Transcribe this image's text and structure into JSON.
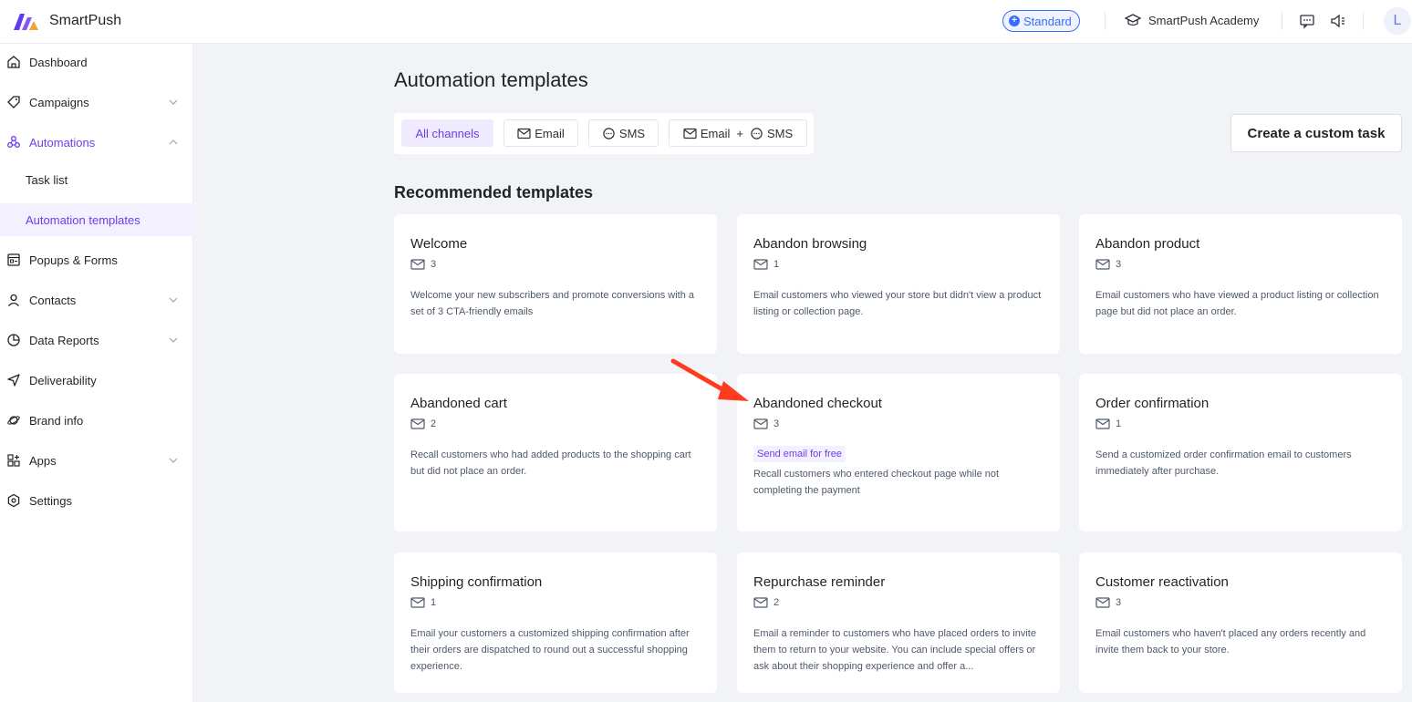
{
  "app": {
    "name": "SmartPush"
  },
  "topbar": {
    "plan_badge": "Standard",
    "academy_label": "SmartPush Academy",
    "avatar_initial": "L",
    "icons": [
      "plan-icon",
      "academy-icon",
      "chat-icon",
      "announcement-icon"
    ]
  },
  "sidebar": {
    "items": [
      {
        "label": "Dashboard",
        "icon": "home-icon"
      },
      {
        "label": "Campaigns",
        "icon": "tag-icon"
      },
      {
        "label": "Automations",
        "icon": "automation-icon"
      },
      {
        "label": "Popups & Forms",
        "icon": "form-icon"
      },
      {
        "label": "Contacts",
        "icon": "user-icon"
      },
      {
        "label": "Data Reports",
        "icon": "pie-chart-icon"
      },
      {
        "label": "Deliverability",
        "icon": "send-icon"
      },
      {
        "label": "Brand info",
        "icon": "planet-icon"
      },
      {
        "label": "Apps",
        "icon": "apps-icon"
      },
      {
        "label": "Settings",
        "icon": "settings-icon"
      }
    ],
    "sub_items": [
      {
        "label": "Task list"
      },
      {
        "label": "Automation templates"
      }
    ]
  },
  "main": {
    "title": "Automation templates",
    "filters": [
      "All channels",
      "Email",
      "SMS",
      "Email",
      "SMS"
    ],
    "filter_plus": "+",
    "custom_task_button": "Create a custom task",
    "section_title": "Recommended templates",
    "cards": [
      {
        "title": "Welcome",
        "count": "3",
        "description": "Welcome your new subscribers and promote conversions with a set of 3 CTA-friendly emails"
      },
      {
        "title": "Abandon browsing",
        "count": "1",
        "description": "Email customers who viewed your store but didn't view a product listing or collection page."
      },
      {
        "title": "Abandon product",
        "count": "3",
        "description": "Email customers who have viewed a product listing or collection page but did not place an order."
      },
      {
        "title": "Abandoned cart",
        "count": "2",
        "description": "Recall customers who had added products to the shopping cart but did not place an order."
      },
      {
        "title": "Abandoned checkout",
        "count": "3",
        "badge": "Send email for free",
        "description": "Recall customers who entered checkout page while not completing the payment"
      },
      {
        "title": "Order confirmation",
        "count": "1",
        "description": "Send a customized order confirmation email to customers immediately after purchase."
      },
      {
        "title": "Shipping confirmation",
        "count": "1",
        "description": "Email your customers a customized shipping confirmation after their orders are dispatched to round out a successful shopping experience."
      },
      {
        "title": "Repurchase reminder",
        "count": "2",
        "description": "Email a reminder to customers who have placed orders to invite them to return to your website. You can include special offers or ask about their shopping experience and offer a..."
      },
      {
        "title": "Customer reactivation",
        "count": "3",
        "description": "Email customers who haven't placed any orders recently and invite them back to your store."
      }
    ]
  },
  "colors": {
    "accent": "#6e3cf0",
    "plan": "#3b6cf6",
    "arrow": "#ff3b1f",
    "background": "#f2f3f7"
  }
}
